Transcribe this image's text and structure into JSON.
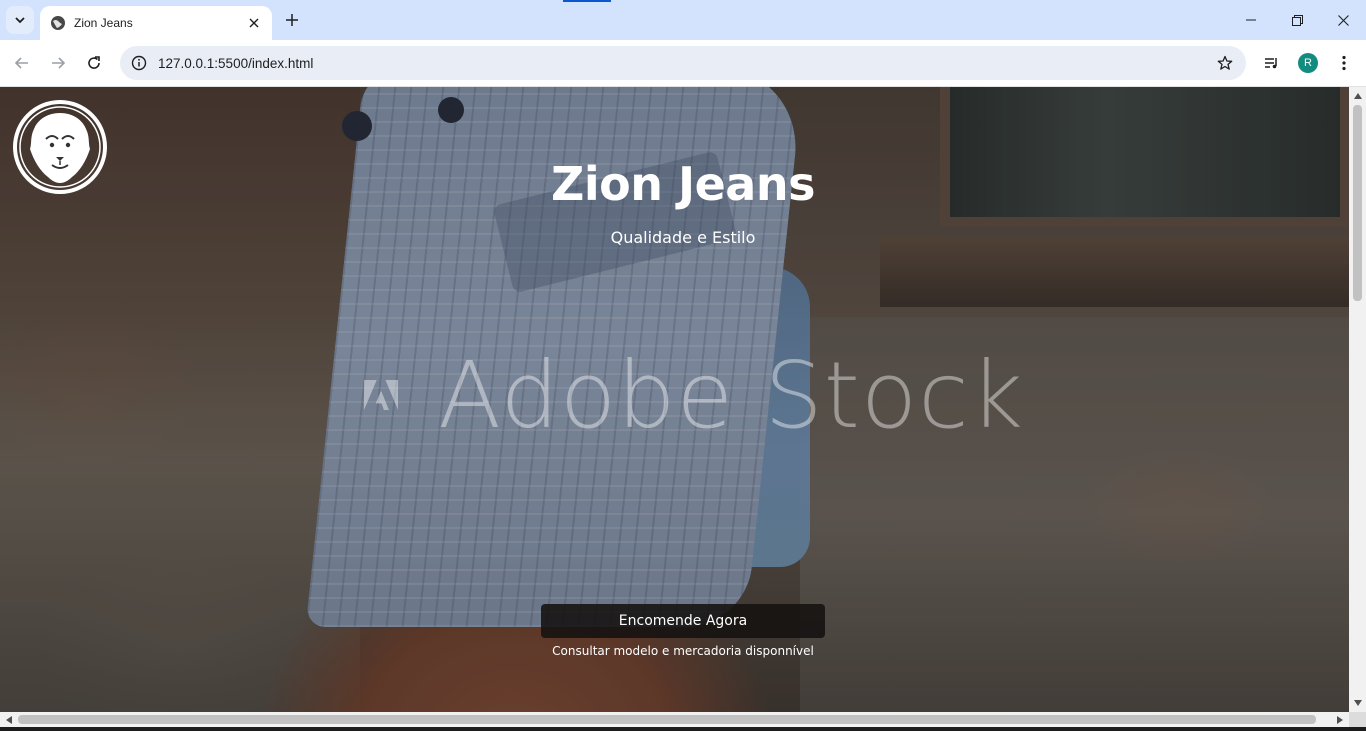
{
  "browser": {
    "tab": {
      "title": "Zion Jeans",
      "favicon": "globe-icon"
    },
    "url": "127.0.0.1:5500/index.html",
    "profile_initial": "R",
    "accent_color": "#0b57d0",
    "icons": {
      "tab_search": "chevron-down-icon",
      "tab_close": "close-icon",
      "new_tab": "plus-icon",
      "minimize": "minimize-icon",
      "restore": "restore-icon",
      "close_window": "close-icon",
      "back": "arrow-left-icon",
      "forward": "arrow-right-icon",
      "reload": "reload-icon",
      "site_info": "info-icon",
      "bookmark": "star-icon",
      "media": "media-queue-icon",
      "menu": "kebab-menu-icon"
    }
  },
  "page": {
    "logo": "lion-logo",
    "title": "Zion Jeans",
    "subtitle": "Qualidade e Estilo",
    "watermark": "Adobe Stock",
    "cta_label": "Encomende Agora",
    "cta_note": "Consultar modelo e mercadoria disponnível"
  }
}
